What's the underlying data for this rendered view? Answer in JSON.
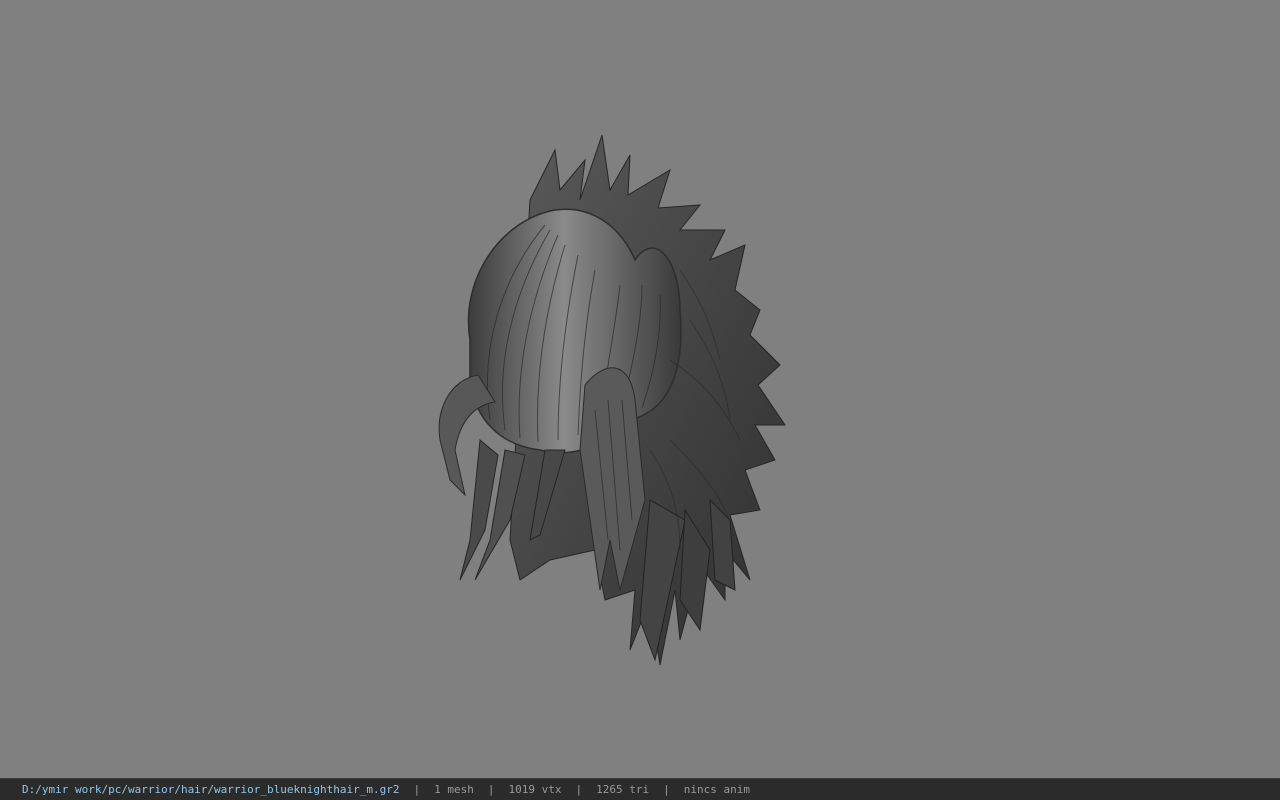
{
  "viewport": {
    "background": "#808080",
    "model_description": "hair mesh preview"
  },
  "status_bar": {
    "file_path": "D:/ymir work/pc/warrior/hair/warrior_blueknighthair_m.gr2",
    "separator": "|",
    "mesh_count": "1 mesh",
    "vertex_count": "1019 vtx",
    "triangle_count": "1265 tri",
    "anim_status": "nincs anim",
    "path_color": "#8fc6e8",
    "bar_color": "#2b2b2b"
  }
}
